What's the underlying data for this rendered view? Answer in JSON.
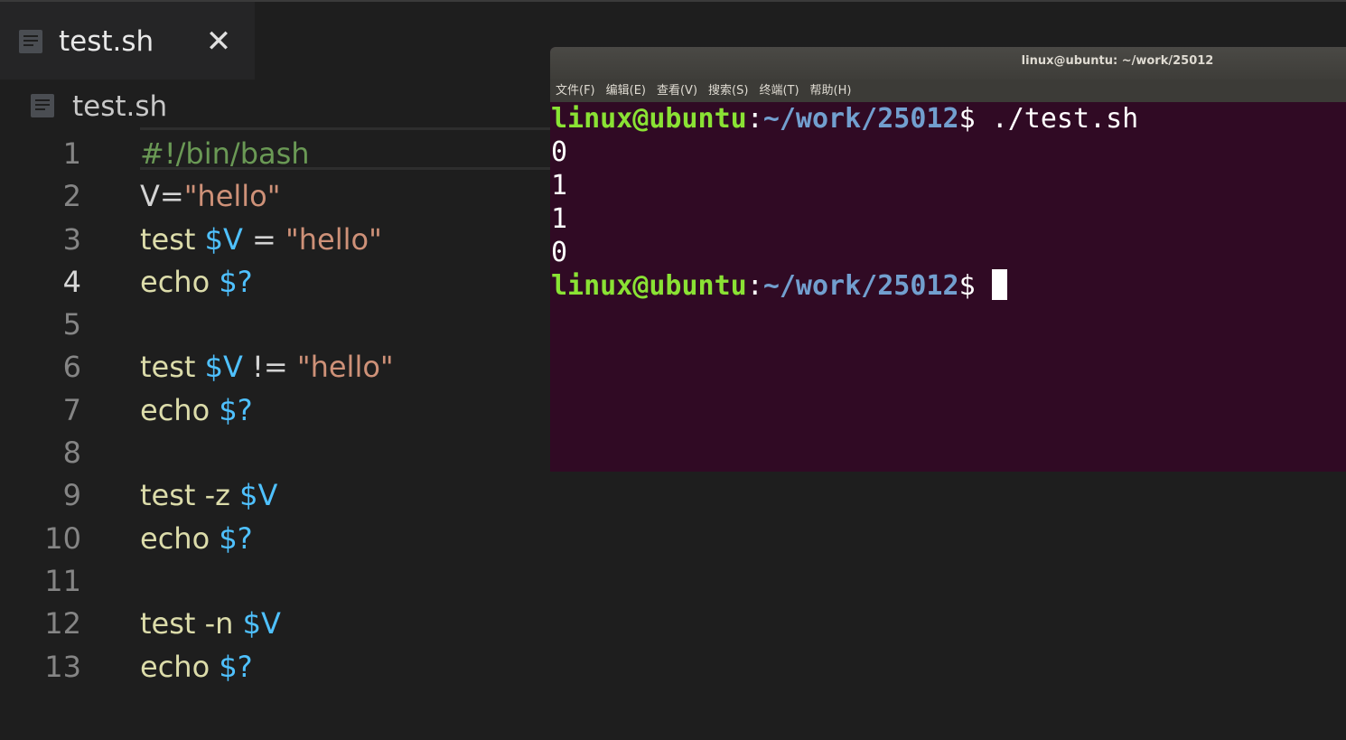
{
  "tab": {
    "label": "test.sh",
    "close": "✕"
  },
  "breadcrumb": {
    "label": "test.sh"
  },
  "editor": {
    "lines": [
      {
        "num": "1",
        "tokens": [
          {
            "t": "#!/bin/bash",
            "k": "comment"
          }
        ]
      },
      {
        "num": "2",
        "tokens": [
          {
            "t": "V=",
            "k": "plain"
          },
          {
            "t": "\"hello\"",
            "k": "str"
          }
        ]
      },
      {
        "num": "3",
        "tokens": [
          {
            "t": "test ",
            "k": "cmd"
          },
          {
            "t": "$V",
            "k": "var"
          },
          {
            "t": " = ",
            "k": "plain"
          },
          {
            "t": "\"hello\"",
            "k": "str"
          }
        ]
      },
      {
        "num": "4",
        "tokens": [
          {
            "t": "echo ",
            "k": "cmd"
          },
          {
            "t": "$?",
            "k": "var"
          }
        ]
      },
      {
        "num": "5",
        "tokens": []
      },
      {
        "num": "6",
        "tokens": [
          {
            "t": "test ",
            "k": "cmd"
          },
          {
            "t": "$V",
            "k": "var"
          },
          {
            "t": " != ",
            "k": "plain"
          },
          {
            "t": "\"hello\"",
            "k": "str"
          }
        ]
      },
      {
        "num": "7",
        "tokens": [
          {
            "t": "echo ",
            "k": "cmd"
          },
          {
            "t": "$?",
            "k": "var"
          }
        ]
      },
      {
        "num": "8",
        "tokens": []
      },
      {
        "num": "9",
        "tokens": [
          {
            "t": "test -z ",
            "k": "cmd"
          },
          {
            "t": "$V",
            "k": "var"
          }
        ]
      },
      {
        "num": "10",
        "tokens": [
          {
            "t": "echo ",
            "k": "cmd"
          },
          {
            "t": "$?",
            "k": "var"
          }
        ]
      },
      {
        "num": "11",
        "tokens": []
      },
      {
        "num": "12",
        "tokens": [
          {
            "t": "test -n ",
            "k": "cmd"
          },
          {
            "t": "$V",
            "k": "var"
          }
        ]
      },
      {
        "num": "13",
        "tokens": [
          {
            "t": "echo ",
            "k": "cmd"
          },
          {
            "t": "$?",
            "k": "var"
          }
        ]
      }
    ],
    "active_line": "4"
  },
  "terminal": {
    "title": "linux@ubuntu: ~/work/25012",
    "menu": [
      "文件(F)",
      "编辑(E)",
      "查看(V)",
      "搜索(S)",
      "终端(T)",
      "帮助(H)"
    ],
    "prompt_user": "linux@ubuntu",
    "prompt_sep": ":",
    "prompt_path": "~/work/25012",
    "prompt_dollar": "$ ",
    "command": "./test.sh",
    "output": [
      "0",
      "1",
      "1",
      "0"
    ]
  },
  "colors": {
    "prompt_user": "#8ae234",
    "prompt_path": "#729fcf",
    "terminal_bg": "#300a24",
    "editor_bg": "#1e1e1e"
  }
}
